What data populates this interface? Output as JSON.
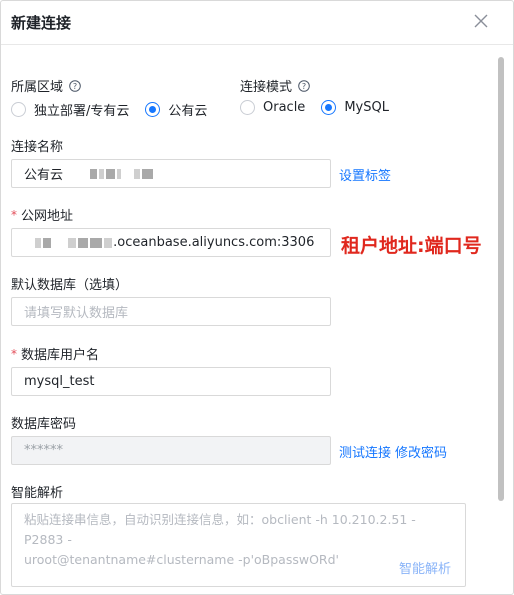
{
  "dialog": {
    "title": "新建连接"
  },
  "region": {
    "label": "所属区域",
    "options": [
      {
        "label": "独立部署/专有云",
        "selected": false
      },
      {
        "label": "公有云",
        "selected": true
      }
    ]
  },
  "mode": {
    "label": "连接模式",
    "options": [
      {
        "label": "Oracle",
        "selected": false
      },
      {
        "label": "MySQL",
        "selected": true
      }
    ]
  },
  "conn_name": {
    "label": "连接名称",
    "value": "公有云",
    "tag_link": "设置标签"
  },
  "public_addr": {
    "required_mark": "*",
    "label": "公网地址",
    "value_suffix": ".oceanbase.aliyuncs.com:3306",
    "annotation": "租户地址:端口号"
  },
  "default_db": {
    "label": "默认数据库（选填）",
    "placeholder": "请填写默认数据库"
  },
  "db_user": {
    "required_mark": "*",
    "label": "数据库用户名",
    "value": "mysql_test"
  },
  "db_password": {
    "label": "数据库密码",
    "value": "******",
    "test_link": "测试连接",
    "change_link": "修改密码"
  },
  "smart_parse": {
    "label": "智能解析",
    "placeholder_line1": "粘贴连接串信息，自动识别连接信息，如：obclient -h 10.210.2.51 -P2883 -",
    "placeholder_line2": "uroot@tenantname#clustername -p'oBpasswORd'",
    "button": "智能解析"
  },
  "colors": {
    "primary": "#1677ff",
    "required": "#e34d59",
    "annotation": "#e0281e"
  }
}
